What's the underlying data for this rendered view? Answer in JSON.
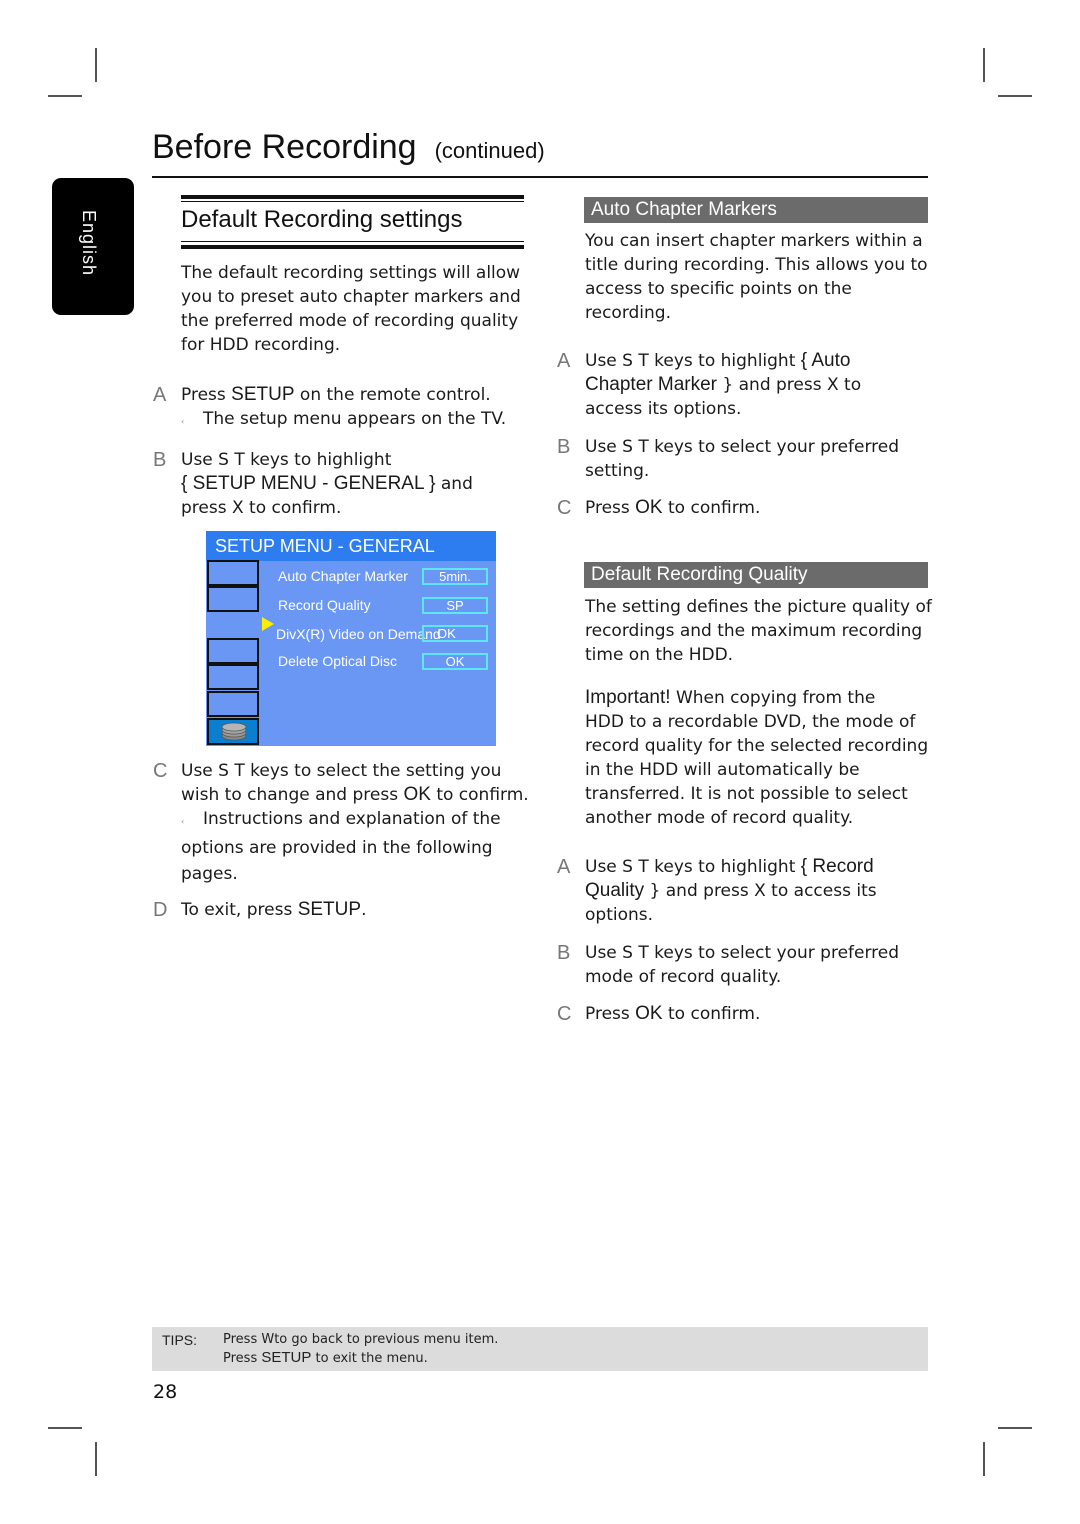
{
  "header": {
    "title": "Before Recording",
    "continued": "(continued)"
  },
  "language_tab": "English",
  "left": {
    "section_title": "Default Recording settings",
    "intro": [
      "The default recording settings will allow",
      "you to preset auto chapter markers and",
      "the preferred mode of recording quality",
      "for HDD recording."
    ],
    "steps": [
      {
        "letter": "A",
        "lines": [
          "Press ",
          "SETUP",
          " on the remote control."
        ],
        "note": "The setup menu appears on the TV."
      },
      {
        "letter": "B",
        "line1": "Use  S T  keys to highlight",
        "line2_key": "{ SETUP MENU - GENERAL  }",
        "line2_rest": " and",
        "line3": "press  X to confirm."
      },
      {
        "letter": "C",
        "line1": "Use  S T  keys to select the setting you",
        "line2_pre": "wish to change and press ",
        "line2_key": "OK",
        "line2_post": "  to confirm.",
        "note1": "Instructions and explanation of the",
        "note2": "options are provided in the following",
        "note3": "pages."
      },
      {
        "letter": "D",
        "pre": "To exit, press ",
        "key": "SETUP",
        "post": "."
      }
    ]
  },
  "setup_menu": {
    "title": "SETUP MENU - GENERAL",
    "items": [
      {
        "label": "Auto Chapter Marker",
        "value": "5min."
      },
      {
        "label": "Record Quality",
        "value": "SP"
      },
      {
        "label": "DivX(R) Video on Demand",
        "value": "OK"
      },
      {
        "label": "Delete Optical Disc",
        "value": "OK"
      }
    ],
    "selected_icon": "disc-stack-icon"
  },
  "right": {
    "auto_chapter": {
      "header": "Auto Chapter Markers",
      "intro": [
        "You can insert chapter markers within a",
        "title during recording. This allows you to",
        "access to specific points on the",
        "recording."
      ],
      "stepA": {
        "letter": "A",
        "l1_pre": "Use  S T  keys to highlight ",
        "l1_key": "{ Auto",
        "l2_key": "Chapter Marker",
        "l2_post": "  } and press  X to",
        "l3": "access its options."
      },
      "stepB": {
        "letter": "B",
        "l1": "Use  S T  keys to select your preferred",
        "l2": "setting."
      },
      "stepC": {
        "letter": "C",
        "pre": "Press ",
        "key": "OK",
        "post": "  to confirm."
      }
    },
    "quality": {
      "header": "Default Recording Quality",
      "intro": [
        "The setting defines the picture quality of",
        "recordings and the maximum recording",
        "time on the HDD."
      ],
      "important_label": "Important!",
      "important": [
        "  When copying from the",
        "HDD to a recordable DVD, the mode of",
        "record quality for the selected recording",
        "in the HDD will automatically be",
        "transferred. It is not possible to select",
        "another mode of record quality."
      ],
      "stepA": {
        "letter": "A",
        "l1_pre": "Use  S T  keys to highlight ",
        "l1_key": "{ Record",
        "l2_key": "Quality",
        "l2_post": "  } and press  X to access its",
        "l3": "options."
      },
      "stepB": {
        "letter": "B",
        "l1": "Use  S T  keys to select your preferred",
        "l2": "mode of record quality."
      },
      "stepC": {
        "letter": "C",
        "pre": "Press ",
        "key": "OK",
        "post": "  to confirm."
      }
    }
  },
  "tips": {
    "label": "TIPS:",
    "line1": "Press  Wto go back to previous menu item.",
    "line2_pre": "Press ",
    "line2_key": "SETUP",
    "line2_post": "  to exit the menu."
  },
  "page_number": "28"
}
